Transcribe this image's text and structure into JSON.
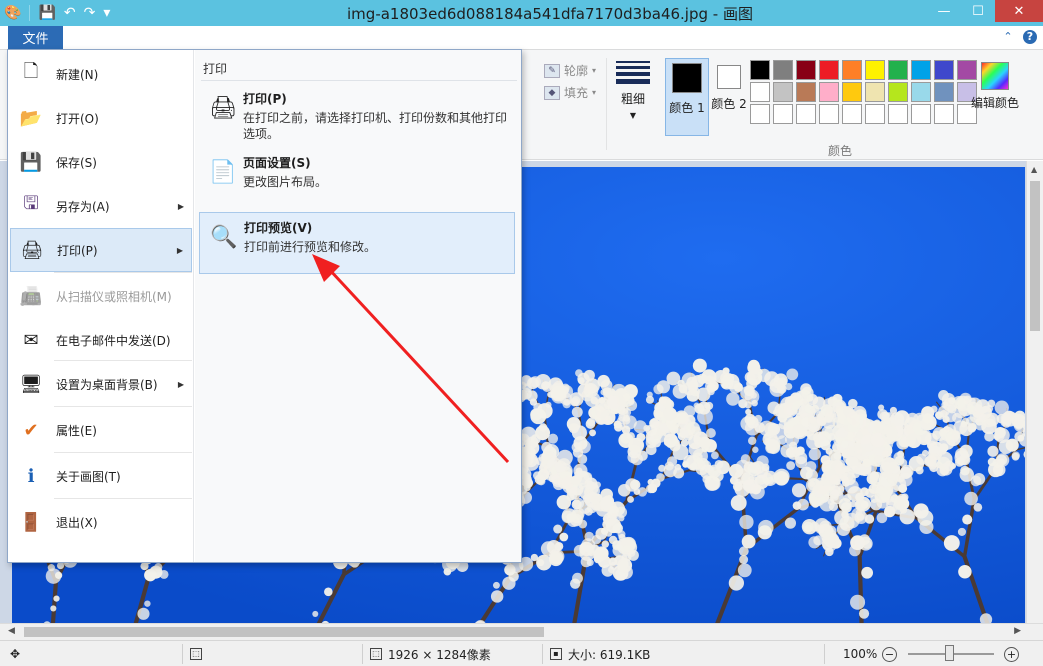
{
  "window": {
    "title": "img-a1803ed6d088184a541dfa7170d3ba46.jpg - 画图",
    "controls": {
      "minimize": "—",
      "maximize": "☐",
      "close": "✕"
    },
    "qat_icons": [
      "paint-app-icon",
      "save-icon",
      "undo-icon",
      "redo-icon",
      "customize-qat-icon"
    ]
  },
  "ribbon": {
    "file_tab": "文件",
    "shape_outline": "轮廓",
    "shape_fill": "填充",
    "thickness": "粗细",
    "color1": "颜色 1",
    "color2": "颜色 2",
    "edit_colors": "编辑颜色",
    "colors_group": "颜色",
    "palette": [
      "#000000",
      "#7f7f7f",
      "#880015",
      "#ed1c24",
      "#ff7f27",
      "#fff200",
      "#22b14c",
      "#00a2e8",
      "#3f48cc",
      "#a349a4",
      "#ffffff",
      "#c3c3c3",
      "#b97a57",
      "#ffaec9",
      "#ffc90e",
      "#efe4b0",
      "#b5e61d",
      "#99d9ea",
      "#7092be",
      "#c8bfe7",
      "#ffffff",
      "#ffffff",
      "#ffffff",
      "#ffffff",
      "#ffffff",
      "#ffffff",
      "#ffffff",
      "#ffffff",
      "#ffffff",
      "#ffffff"
    ],
    "color1_value": "#000000",
    "color2_value": "#ffffff"
  },
  "file_menu": {
    "items": [
      {
        "label": "新建(N)",
        "icon": "new-file-icon",
        "has_sub": false
      },
      {
        "label": "打开(O)",
        "icon": "open-folder-icon",
        "has_sub": false
      },
      {
        "label": "保存(S)",
        "icon": "save-icon",
        "has_sub": false
      },
      {
        "label": "另存为(A)",
        "icon": "save-as-icon",
        "has_sub": true
      },
      {
        "label": "打印(P)",
        "icon": "printer-icon",
        "has_sub": true
      },
      {
        "label": "从扫描仪或照相机(M)",
        "icon": "scanner-icon",
        "has_sub": false
      },
      {
        "label": "在电子邮件中发送(D)",
        "icon": "email-icon",
        "has_sub": false
      },
      {
        "label": "设置为桌面背景(B)",
        "icon": "desktop-background-icon",
        "has_sub": true
      },
      {
        "label": "属性(E)",
        "icon": "checkmark-icon",
        "has_sub": false
      },
      {
        "label": "关于画图(T)",
        "icon": "info-icon",
        "has_sub": false
      },
      {
        "label": "退出(X)",
        "icon": "exit-icon",
        "has_sub": false
      }
    ],
    "submenu": {
      "header": "打印",
      "items": [
        {
          "title": "打印(P)",
          "desc": "在打印之前，请选择打印机、打印份数和其他打印选项。",
          "icon": "printer-icon"
        },
        {
          "title": "页面设置(S)",
          "desc": "更改图片布局。",
          "icon": "page-setup-icon"
        },
        {
          "title": "打印预览(V)",
          "desc": "打印前进行预览和修改。",
          "icon": "print-preview-icon"
        }
      ]
    }
  },
  "status": {
    "dimensions": "1926 × 1284像素",
    "size": "大小: 619.1KB",
    "zoom": "100%",
    "zoom_level_percent": 100
  }
}
